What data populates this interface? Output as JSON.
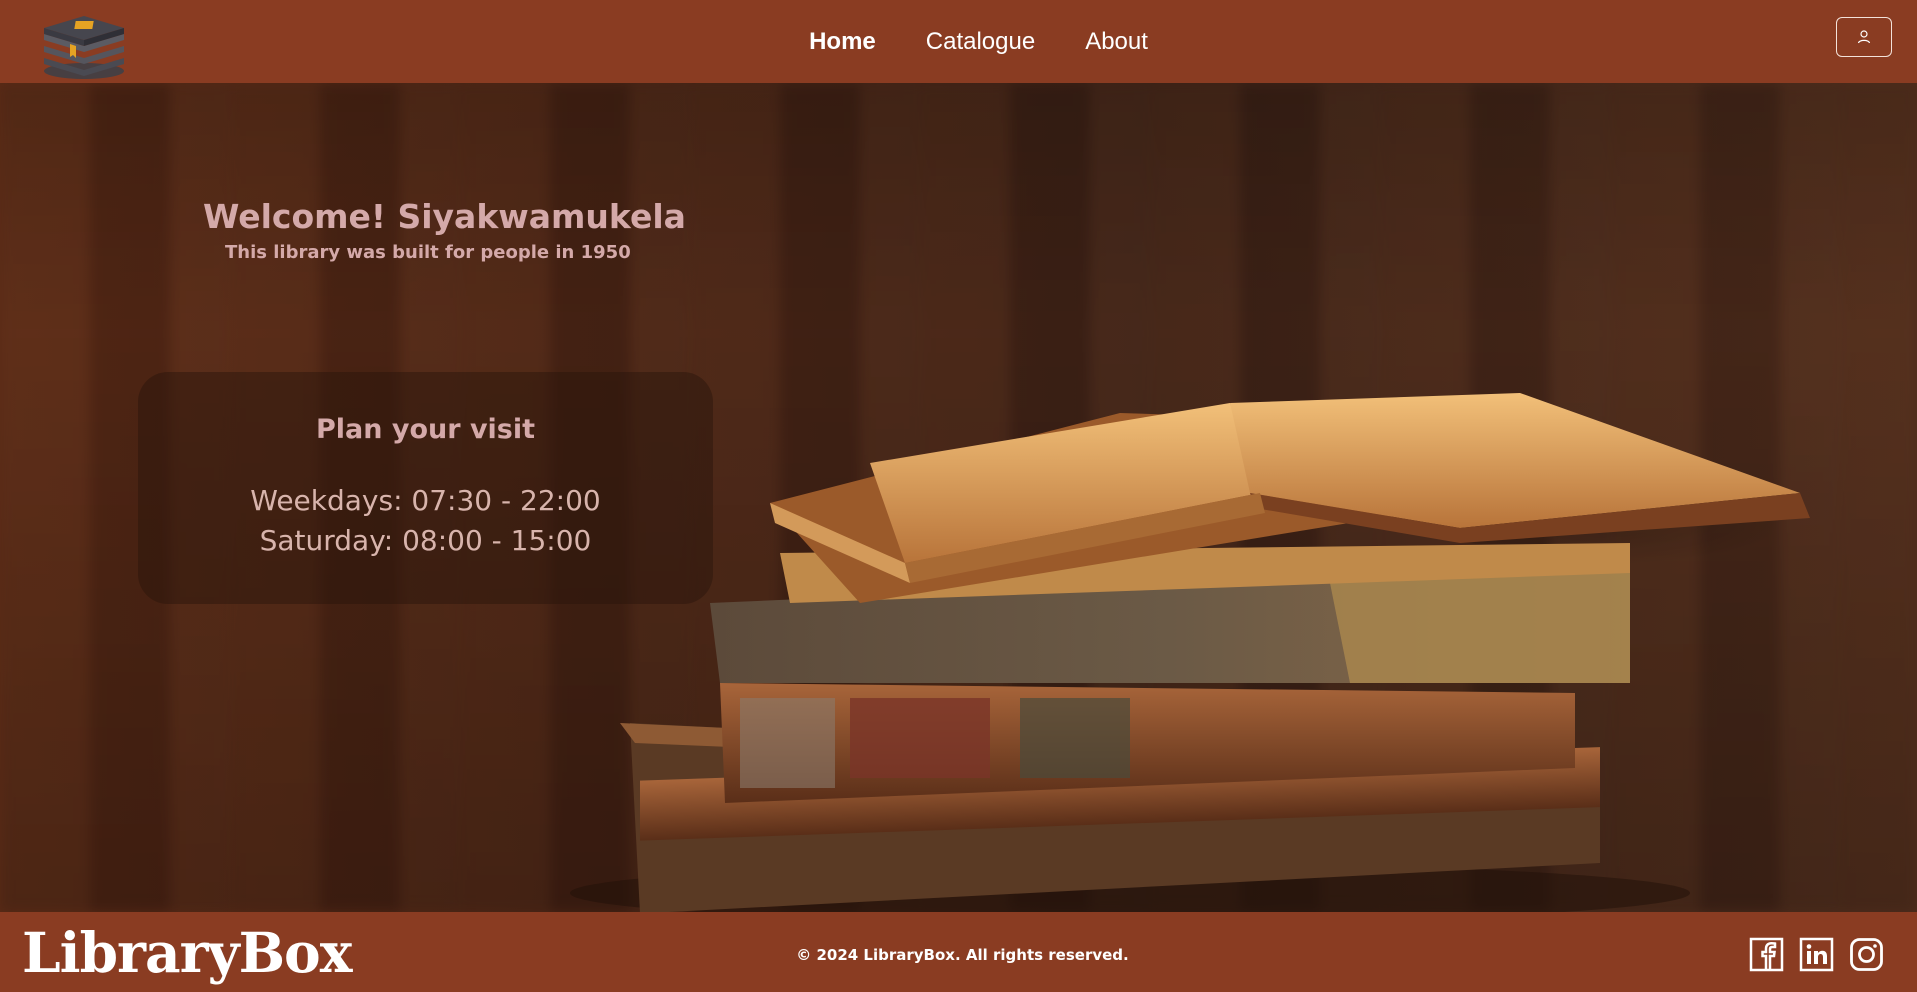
{
  "nav": {
    "items": [
      {
        "label": "Home",
        "active": true
      },
      {
        "label": "Catalogue",
        "active": false
      },
      {
        "label": "About",
        "active": false
      }
    ]
  },
  "hero": {
    "title": "Welcome! Siyakwamukela",
    "subtitle": "This library was built for people in 1950"
  },
  "visit": {
    "title": "Plan your visit",
    "weekdays": "Weekdays: 07:30 - 22:00",
    "saturday": "Saturday: 08:00 - 15:00"
  },
  "footer": {
    "brand": "LibraryBox",
    "copyright": "© 2024 LibraryBox. All rights reserved."
  },
  "icons": {
    "logo": "book-stack-icon",
    "user": "user-icon",
    "social": [
      "facebook-icon",
      "linkedin-icon",
      "instagram-icon"
    ]
  },
  "colors": {
    "header": "#8a3c22",
    "text_accent": "#d4a9a9"
  }
}
